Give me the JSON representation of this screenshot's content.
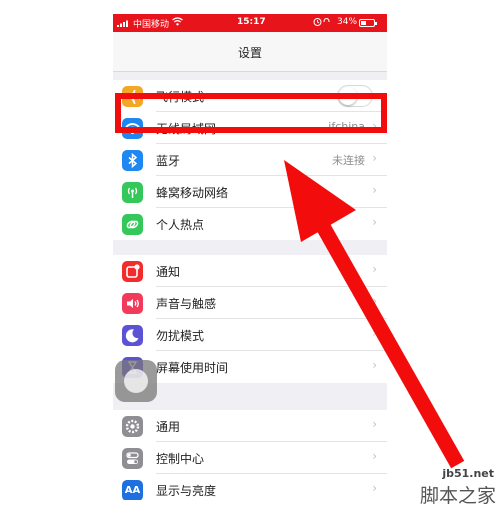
{
  "statusbar": {
    "carrier": "中国移动",
    "time": "15:17",
    "battery": "34%"
  },
  "navbar": {
    "title": "设置"
  },
  "group1": [
    {
      "label": "飞行模式",
      "icon": "airplane-icon",
      "color": "#f5a623",
      "toggle": true
    },
    {
      "label": "无线局域网",
      "icon": "wifi-icon",
      "color": "#1e88f0",
      "value": "jfchina"
    },
    {
      "label": "蓝牙",
      "icon": "bluetooth-icon",
      "color": "#1e88f0",
      "value": "未连接"
    },
    {
      "label": "蜂窝移动网络",
      "icon": "cellular-icon",
      "color": "#34c759"
    },
    {
      "label": "个人热点",
      "icon": "hotspot-icon",
      "color": "#34c759"
    }
  ],
  "group2": [
    {
      "label": "通知",
      "icon": "notification-icon",
      "color": "#f22b2b"
    },
    {
      "label": "声音与触感",
      "icon": "sound-icon",
      "color": "#f23a5a"
    },
    {
      "label": "勿扰模式",
      "icon": "moon-icon",
      "color": "#5b52d6"
    },
    {
      "label": "屏幕使用时间",
      "icon": "hourglass-icon",
      "color": "#5b52d6"
    }
  ],
  "group3": [
    {
      "label": "通用",
      "icon": "gear-icon",
      "color": "#8e8e93"
    },
    {
      "label": "控制中心",
      "icon": "control-center-icon",
      "color": "#8e8e93"
    },
    {
      "label": "显示与亮度",
      "icon": "brightness-icon",
      "color": "#1e6fe0"
    }
  ],
  "annotation": {
    "highlight_color": "#f20c0c",
    "arrow_color": "#f20c0c"
  },
  "watermark": {
    "url": "jb51.net",
    "site": "脚本之家"
  }
}
